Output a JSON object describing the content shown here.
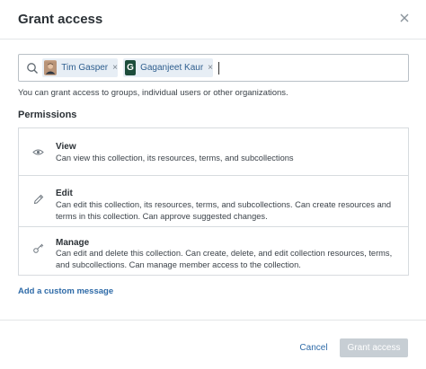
{
  "dialog": {
    "title": "Grant access"
  },
  "picker": {
    "chips": [
      {
        "name": "Tim Gasper",
        "avatar": "photo",
        "remove": "×"
      },
      {
        "name": "Gaganjeet Kaur",
        "avatar_letter": "G",
        "remove": "×"
      }
    ]
  },
  "helper_text": "You can grant access to groups, individual users or other organizations.",
  "permissions": {
    "heading": "Permissions",
    "items": [
      {
        "title": "View",
        "icon": "eye-icon",
        "description": "Can view this collection, its resources, terms, and subcollections"
      },
      {
        "title": "Edit",
        "icon": "pencil-icon",
        "description": "Can edit this collection, its resources, terms, and subcollections. Can create resources and terms in this collection. Can approve suggested changes."
      },
      {
        "title": "Manage",
        "icon": "key-icon",
        "description": "Can edit and delete this collection. Can create, delete, and edit collection resources, terms, and subcollections. Can manage member access to the collection."
      }
    ]
  },
  "custom_message_link": "Add a custom message",
  "footer": {
    "cancel_label": "Cancel",
    "grant_label": "Grant access"
  },
  "colors": {
    "link": "#2f6ba8",
    "chip_bg": "#e7eef5",
    "disabled_button": "#c7ced4",
    "avatar_green": "#1d4d3b"
  }
}
